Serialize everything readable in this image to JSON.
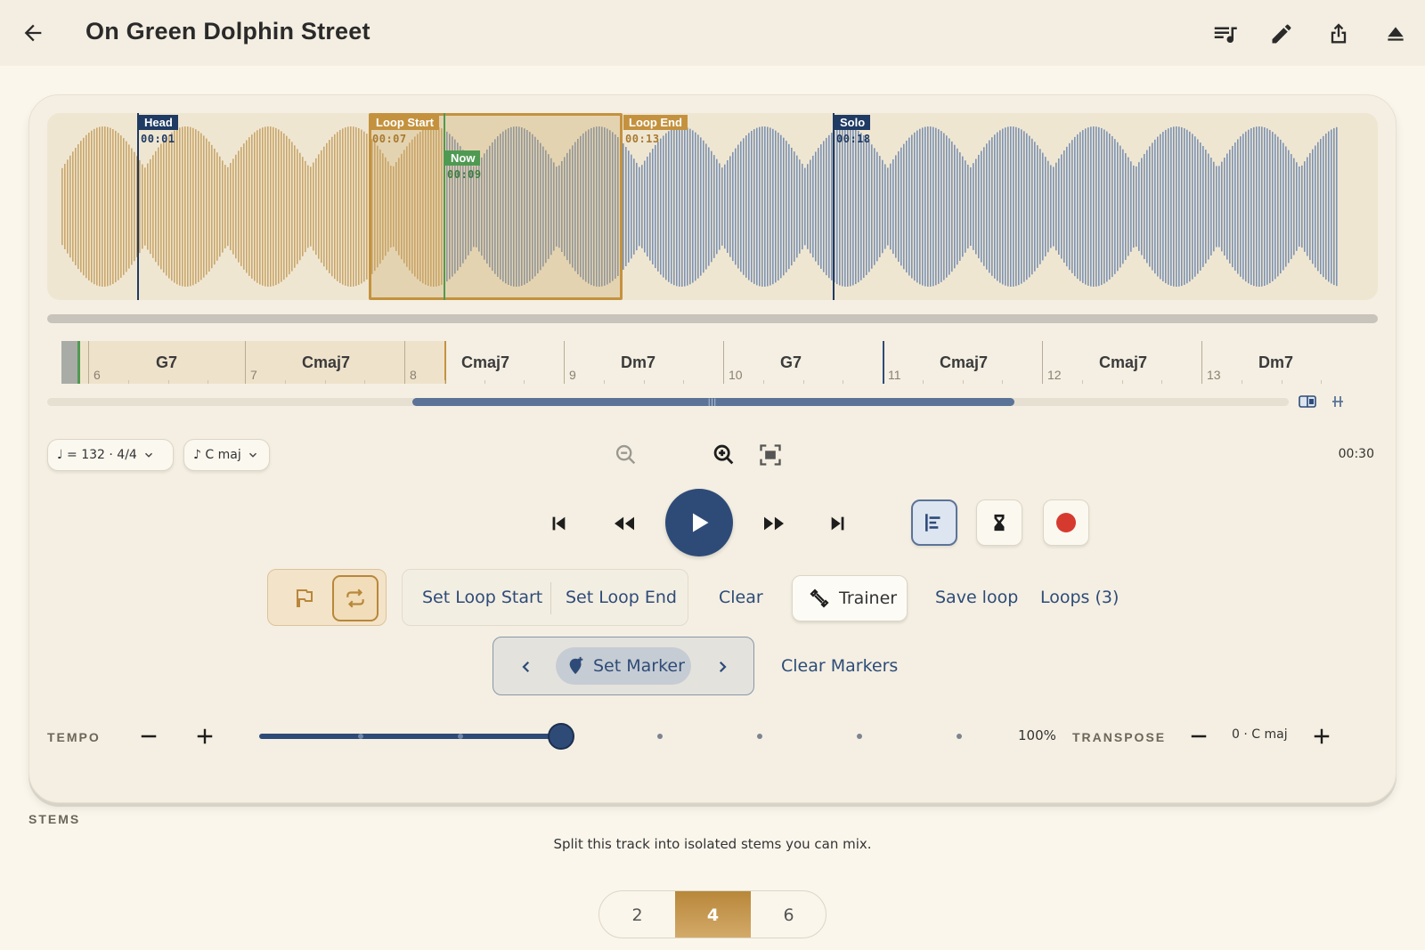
{
  "header": {
    "title": "On Green Dolphin Street"
  },
  "waveform": {
    "markers": [
      {
        "label": "Head",
        "time": "00:01",
        "color": "#1f3a63"
      },
      {
        "label": "Loop Start",
        "time": "00:07",
        "color": "#c4923e"
      },
      {
        "label": "Now",
        "time": "00:09",
        "color": "#4f9a52"
      },
      {
        "label": "Loop End",
        "time": "00:13",
        "color": "#c4923e"
      },
      {
        "label": "Solo",
        "time": "00:18",
        "color": "#1f3a63"
      }
    ],
    "played_color": "#c9a66a",
    "unplayed_color": "#7d93b3"
  },
  "chords": [
    {
      "bar": "6",
      "name": "G7"
    },
    {
      "bar": "7",
      "name": "Cmaj7"
    },
    {
      "bar": "8",
      "name": "Cmaj7"
    },
    {
      "bar": "9",
      "name": "Dm7"
    },
    {
      "bar": "10",
      "name": "G7"
    },
    {
      "bar": "11",
      "name": "Cmaj7"
    },
    {
      "bar": "12",
      "name": "Cmaj7"
    },
    {
      "bar": "13",
      "name": "Dm7"
    }
  ],
  "controls": {
    "tempo_pill": "♩ = 132 · 4/4",
    "key_pill": "♪ C maj",
    "duration": "00:30"
  },
  "loop": {
    "set_start": "Set Loop Start",
    "set_end": "Set Loop End",
    "clear": "Clear",
    "trainer": "Trainer",
    "save": "Save loop",
    "loops": "Loops (3)"
  },
  "markers_row": {
    "set_marker": "Set Marker",
    "clear_markers": "Clear Markers"
  },
  "tempo": {
    "label": "TEMPO",
    "value": "100%"
  },
  "transpose": {
    "label": "TRANSPOSE",
    "value": "0 · C maj"
  },
  "stems": {
    "label": "STEMS",
    "hint": "Split this track into isolated stems you can mix.",
    "options": [
      "2",
      "4",
      "6"
    ],
    "selected": "4"
  }
}
